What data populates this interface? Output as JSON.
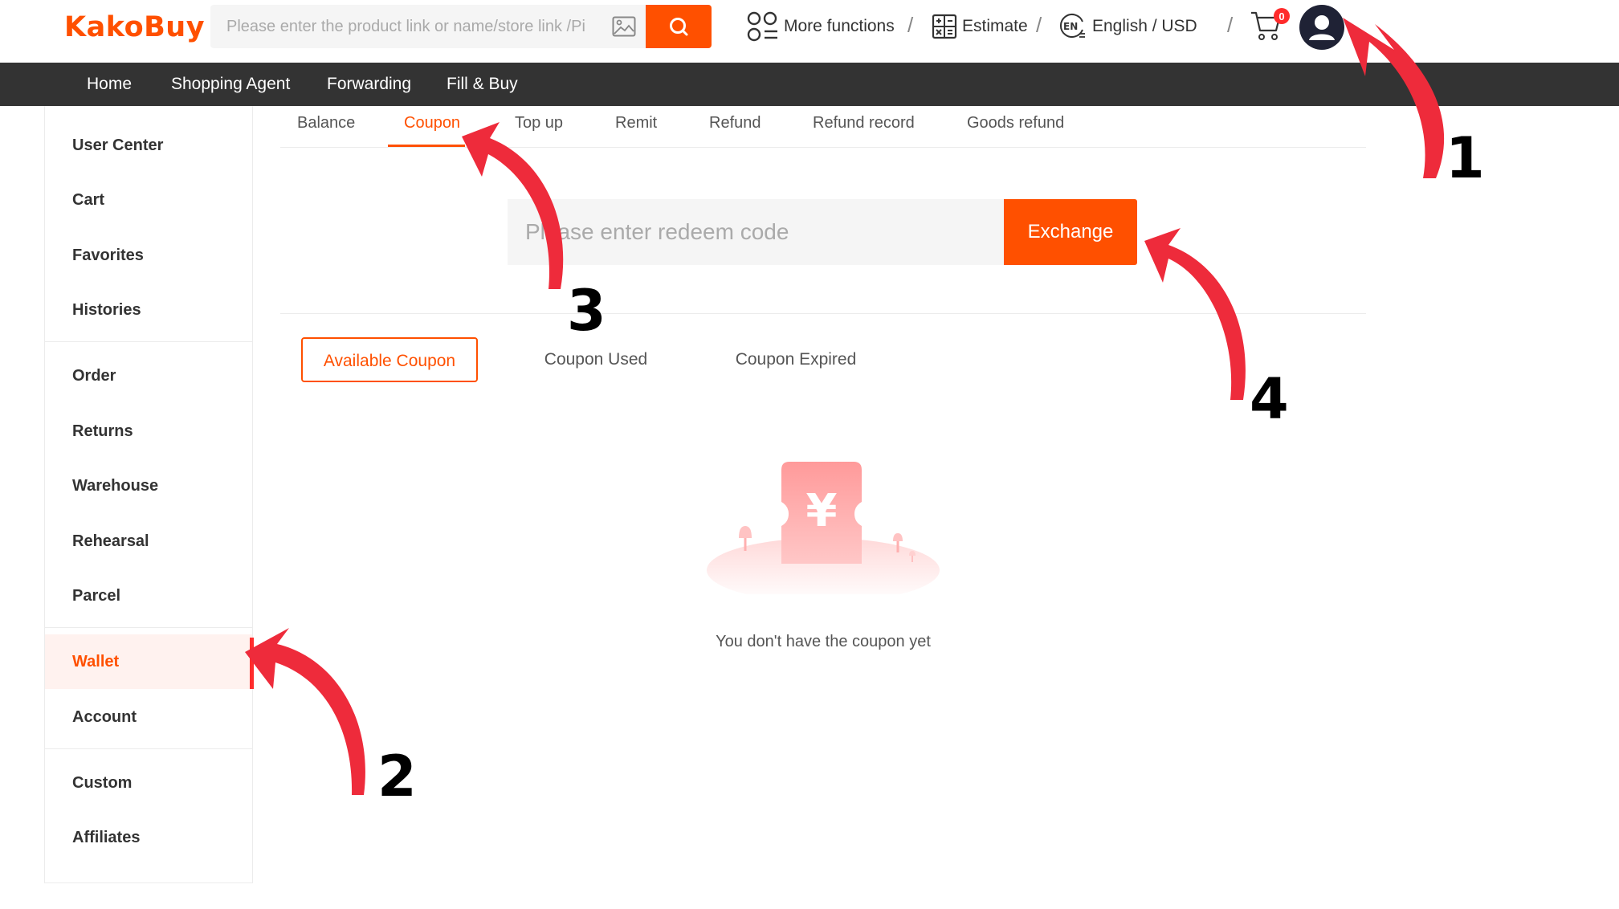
{
  "header": {
    "logo": "KakoBuy",
    "search": {
      "placeholder": "Please enter the product link or name/store link /Pi"
    },
    "more_functions": "More functions",
    "estimate": "Estimate",
    "language_currency": "English / USD",
    "cart_count": "0"
  },
  "main_nav": {
    "items": [
      "Home",
      "Shopping Agent",
      "Forwarding",
      "Fill & Buy"
    ]
  },
  "sidebar": {
    "items": [
      "User Center",
      "Cart",
      "Favorites",
      "Histories",
      "Order",
      "Returns",
      "Warehouse",
      "Rehearsal",
      "Parcel",
      "Wallet",
      "Account",
      "Custom",
      "Affiliates"
    ],
    "active": "Wallet"
  },
  "wallet_tabs": {
    "items": [
      "Balance",
      "Coupon",
      "Top up",
      "Remit",
      "Refund",
      "Refund record",
      "Goods refund"
    ],
    "active": "Coupon"
  },
  "redeem": {
    "placeholder": "Please enter redeem code",
    "button": "Exchange"
  },
  "coupon_tabs": {
    "items": [
      "Available Coupon",
      "Coupon Used",
      "Coupon Expired"
    ],
    "active": "Available Coupon"
  },
  "empty": {
    "icon_symbol": "¥",
    "message": "You don't have the coupon yet"
  },
  "annotations": {
    "numbers": [
      "1",
      "2",
      "3",
      "4"
    ],
    "color": "#ee2b3b"
  },
  "colors": {
    "accent": "#ff5000",
    "nav_bg": "#333333",
    "arrow_red": "#ee2b3b"
  }
}
